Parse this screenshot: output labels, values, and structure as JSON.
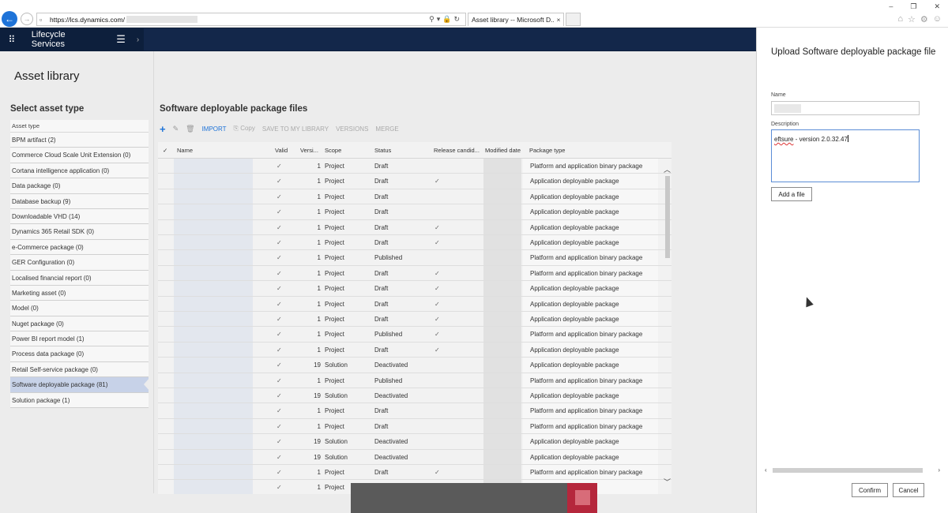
{
  "browser": {
    "url": "https://lcs.dynamics.com/",
    "tab_title": "Asset library -- Microsoft D...",
    "tab_close": "×",
    "window_controls": [
      "–",
      "❐",
      "✕"
    ],
    "icons": [
      "home-icon",
      "star-icon",
      "gear-icon",
      "smiley-icon"
    ]
  },
  "app": {
    "title": "Lifecycle Services"
  },
  "page": {
    "title": "Asset library"
  },
  "asset_types": {
    "heading": "Select asset type",
    "column_header": "Asset type",
    "items": [
      "BPM artifact (2)",
      "Commerce Cloud Scale Unit Extension (0)",
      "Cortana intelligence application (0)",
      "Data package (0)",
      "Database backup (9)",
      "Downloadable VHD (14)",
      "Dynamics 365 Retail SDK (0)",
      "e-Commerce package (0)",
      "GER Configuration (0)",
      "Localised financial report (0)",
      "Marketing asset (0)",
      "Model (0)",
      "Nuget package (0)",
      "Power BI report model (1)",
      "Process data package (0)",
      "Retail Self-service package (0)",
      "Software deployable package (81)",
      "Solution package (1)"
    ],
    "selected_index": 16
  },
  "packages": {
    "heading": "Software deployable package files",
    "toolbar": {
      "import": "IMPORT",
      "copy": "Copy",
      "save_to_library": "SAVE TO MY LIBRARY",
      "versions": "VERSIONS",
      "merge": "MERGE"
    },
    "columns": [
      "Name",
      "Valid",
      "Versi...",
      "Scope",
      "Status",
      "Release candid...",
      "Modified date",
      "Package type"
    ],
    "rows": [
      {
        "valid": "✓",
        "version": "1",
        "scope": "Project",
        "status": "Draft",
        "rc": "",
        "type": "Platform and application binary package"
      },
      {
        "valid": "✓",
        "version": "1",
        "scope": "Project",
        "status": "Draft",
        "rc": "✓",
        "type": "Application deployable package"
      },
      {
        "valid": "✓",
        "version": "1",
        "scope": "Project",
        "status": "Draft",
        "rc": "",
        "type": "Application deployable package"
      },
      {
        "valid": "✓",
        "version": "1",
        "scope": "Project",
        "status": "Draft",
        "rc": "",
        "type": "Application deployable package"
      },
      {
        "valid": "✓",
        "version": "1",
        "scope": "Project",
        "status": "Draft",
        "rc": "✓",
        "type": "Application deployable package"
      },
      {
        "valid": "✓",
        "version": "1",
        "scope": "Project",
        "status": "Draft",
        "rc": "✓",
        "type": "Application deployable package"
      },
      {
        "valid": "✓",
        "version": "1",
        "scope": "Project",
        "status": "Published",
        "rc": "",
        "type": "Platform and application binary package"
      },
      {
        "valid": "✓",
        "version": "1",
        "scope": "Project",
        "status": "Draft",
        "rc": "✓",
        "type": "Platform and application binary package"
      },
      {
        "valid": "✓",
        "version": "1",
        "scope": "Project",
        "status": "Draft",
        "rc": "✓",
        "type": "Application deployable package"
      },
      {
        "valid": "✓",
        "version": "1",
        "scope": "Project",
        "status": "Draft",
        "rc": "✓",
        "type": "Application deployable package"
      },
      {
        "valid": "✓",
        "version": "1",
        "scope": "Project",
        "status": "Draft",
        "rc": "✓",
        "type": "Application deployable package"
      },
      {
        "valid": "✓",
        "version": "1",
        "scope": "Project",
        "status": "Published",
        "rc": "✓",
        "type": "Platform and application binary package"
      },
      {
        "valid": "✓",
        "version": "1",
        "scope": "Project",
        "status": "Draft",
        "rc": "✓",
        "type": "Application deployable package"
      },
      {
        "valid": "✓",
        "version": "19",
        "scope": "Solution",
        "status": "Deactivated",
        "rc": "",
        "type": "Application deployable package"
      },
      {
        "valid": "✓",
        "version": "1",
        "scope": "Project",
        "status": "Published",
        "rc": "",
        "type": "Platform and application binary package"
      },
      {
        "valid": "✓",
        "version": "19",
        "scope": "Solution",
        "status": "Deactivated",
        "rc": "",
        "type": "Application deployable package"
      },
      {
        "valid": "✓",
        "version": "1",
        "scope": "Project",
        "status": "Draft",
        "rc": "",
        "type": "Platform and application binary package"
      },
      {
        "valid": "✓",
        "version": "1",
        "scope": "Project",
        "status": "Draft",
        "rc": "",
        "type": "Platform and application binary package"
      },
      {
        "valid": "✓",
        "version": "19",
        "scope": "Solution",
        "status": "Deactivated",
        "rc": "",
        "type": "Application deployable package"
      },
      {
        "valid": "✓",
        "version": "19",
        "scope": "Solution",
        "status": "Deactivated",
        "rc": "",
        "type": "Application deployable package"
      },
      {
        "valid": "✓",
        "version": "1",
        "scope": "Project",
        "status": "Draft",
        "rc": "✓",
        "type": "Platform and application binary package"
      },
      {
        "valid": "✓",
        "version": "1",
        "scope": "Project",
        "status": "",
        "rc": "",
        "type": "...ge package"
      }
    ]
  },
  "panel": {
    "title": "Upload Software deployable package file",
    "name_label": "Name",
    "description_label": "Description",
    "description_word1": "eftsure",
    "description_rest": " - version 2.0.32.47",
    "add_file": "Add a file",
    "confirm": "Confirm",
    "cancel": "Cancel"
  }
}
